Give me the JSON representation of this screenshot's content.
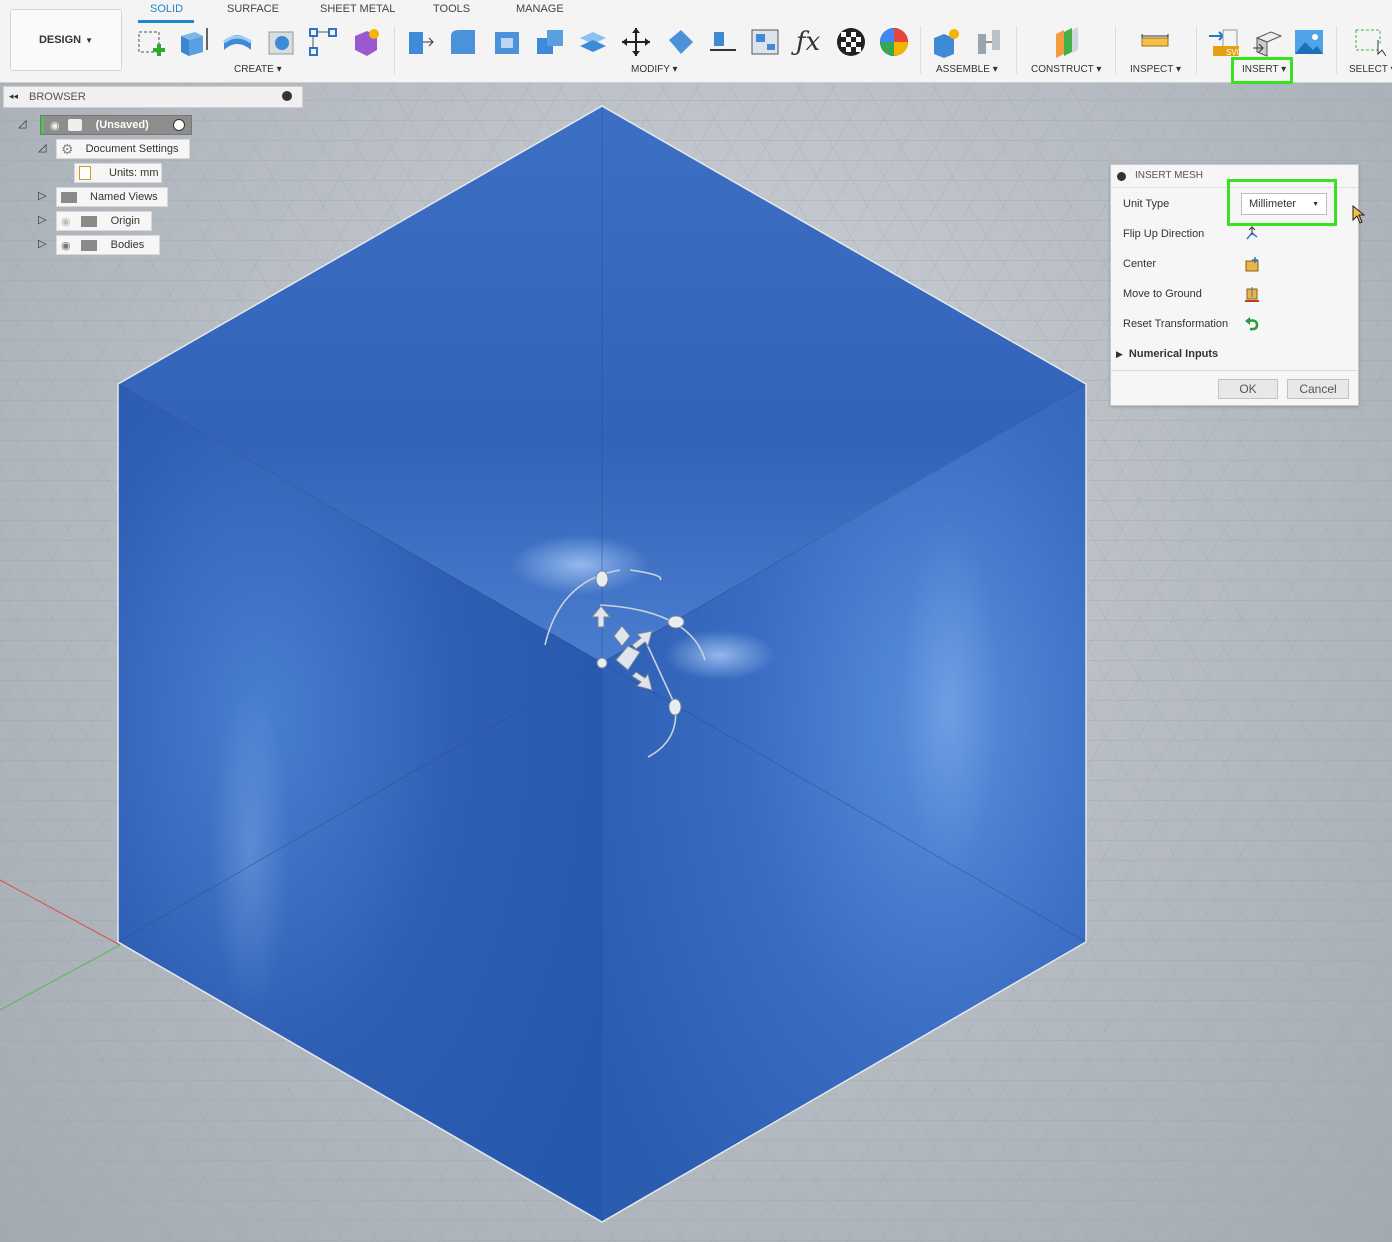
{
  "workspace_button": "DESIGN",
  "tabs": [
    {
      "label": "SOLID",
      "active": true
    },
    {
      "label": "SURFACE"
    },
    {
      "label": "SHEET METAL"
    },
    {
      "label": "TOOLS"
    },
    {
      "label": "MANAGE"
    }
  ],
  "groups": {
    "create": "CREATE",
    "modify": "MODIFY",
    "assemble": "ASSEMBLE",
    "construct": "CONSTRUCT",
    "inspect": "INSPECT",
    "insert": "INSERT",
    "select": "SELECT"
  },
  "browser": {
    "title": "BROWSER",
    "root": "(Unsaved)",
    "items": {
      "document_settings": "Document Settings",
      "units": "Units: mm",
      "named_views": "Named Views",
      "origin": "Origin",
      "bodies": "Bodies"
    }
  },
  "dialog": {
    "title": "INSERT MESH",
    "unit_type_label": "Unit Type",
    "unit_value": "Millimeter",
    "flip_up_label": "Flip Up Direction",
    "center_label": "Center",
    "move_to_ground_label": "Move to Ground",
    "reset_transformation_label": "Reset Transformation",
    "numerical_inputs_label": "Numerical Inputs",
    "ok_label": "OK",
    "cancel_label": "Cancel"
  },
  "colors": {
    "accent": "#1e88c8",
    "highlight": "#39e21f",
    "body": "#3f73c4"
  }
}
